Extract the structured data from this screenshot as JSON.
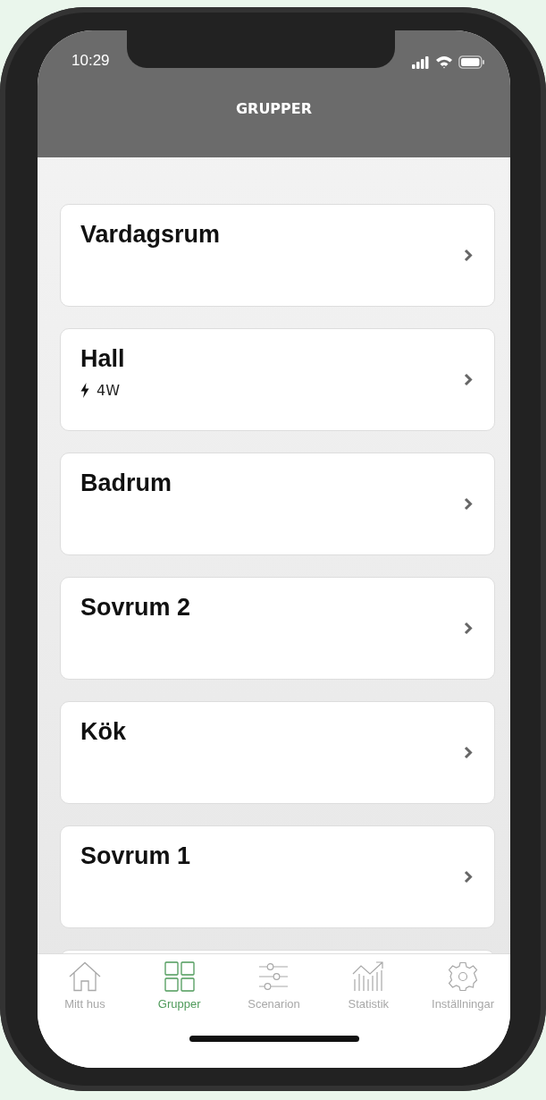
{
  "status_bar": {
    "time": "10:29"
  },
  "header": {
    "title": "GRUPPER"
  },
  "groups": [
    {
      "name": "Vardagsrum"
    },
    {
      "name": "Hall",
      "power": "4W"
    },
    {
      "name": "Badrum"
    },
    {
      "name": "Sovrum 2"
    },
    {
      "name": "Kök"
    },
    {
      "name": "Sovrum 1"
    }
  ],
  "tabs": [
    {
      "kind": "home",
      "label": "Mitt hus",
      "selected": false
    },
    {
      "kind": "groups",
      "label": "Grupper",
      "selected": true
    },
    {
      "kind": "scenes",
      "label": "Scenarion",
      "selected": false
    },
    {
      "kind": "stats",
      "label": "Statistik",
      "selected": false
    },
    {
      "kind": "settings",
      "label": "Inställningar",
      "selected": false
    }
  ]
}
